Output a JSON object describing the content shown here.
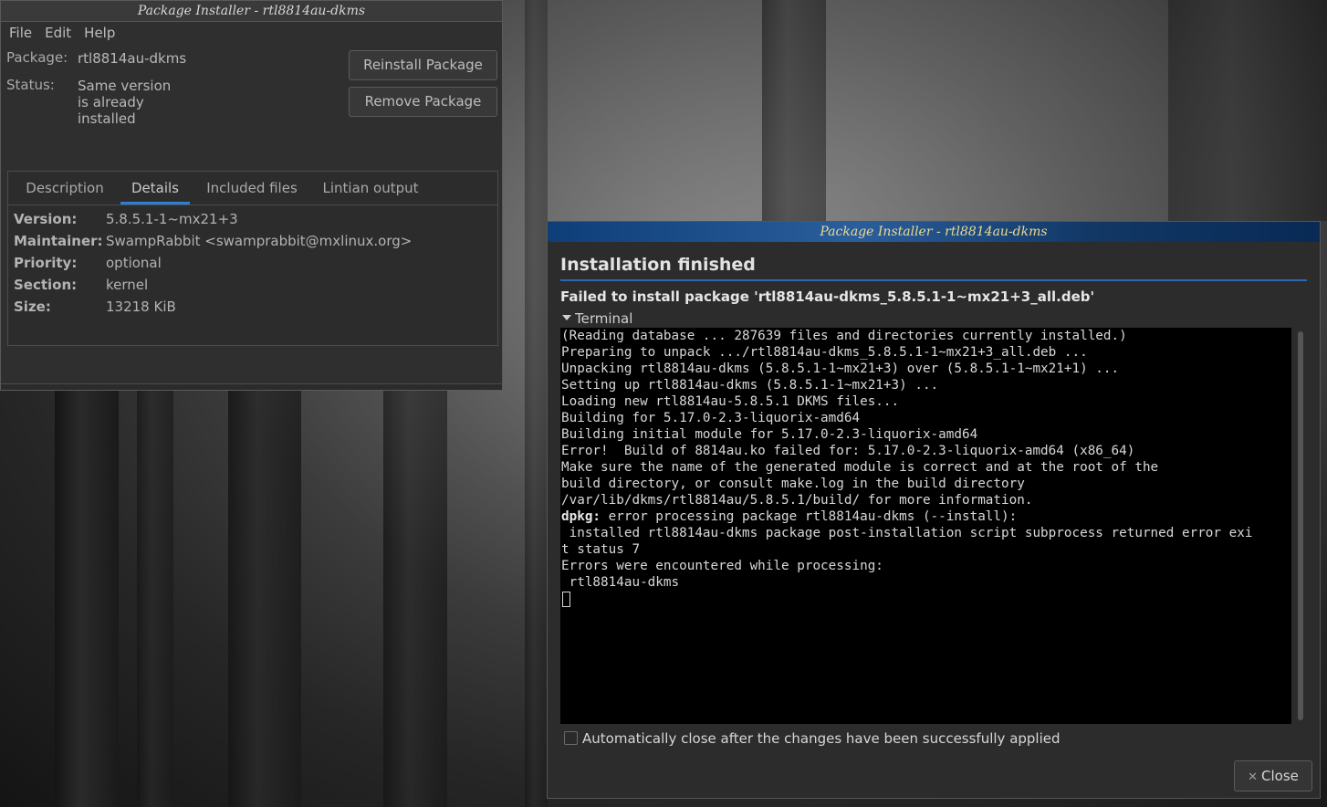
{
  "main_window": {
    "title": "Package Installer - rtl8814au-dkms",
    "menu": [
      "File",
      "Edit",
      "Help"
    ],
    "package_label": "Package:",
    "package_value": "rtl8814au-dkms",
    "status_label": "Status:",
    "status_lines": [
      "Same version",
      "is already",
      "installed"
    ],
    "reinstall_button": "Reinstall Package",
    "remove_button": "Remove Package",
    "tabs": [
      "Description",
      "Details",
      "Included files",
      "Lintian output"
    ],
    "active_tab": "Details",
    "details": [
      {
        "key": "Version:",
        "value": "5.8.5.1-1~mx21+3"
      },
      {
        "key": "Maintainer:",
        "value": "SwampRabbit <swamprabbit@mxlinux.org>"
      },
      {
        "key": "Priority:",
        "value": "optional"
      },
      {
        "key": "Section:",
        "value": "kernel"
      },
      {
        "key": "Size:",
        "value": "13218 KiB"
      }
    ]
  },
  "dialog": {
    "title": "Package Installer - rtl8814au-dkms",
    "heading": "Installation finished",
    "fail_message": "Failed to install package 'rtl8814au-dkms_5.8.5.1-1~mx21+3_all.deb'",
    "terminal_label": "Terminal",
    "terminal_lines": [
      "(Reading database ... 287639 files and directories currently installed.)",
      "Preparing to unpack .../rtl8814au-dkms_5.8.5.1-1~mx21+3_all.deb ...",
      "Unpacking rtl8814au-dkms (5.8.5.1-1~mx21+3) over (5.8.5.1-1~mx21+1) ...",
      "Setting up rtl8814au-dkms (5.8.5.1-1~mx21+3) ...",
      "Loading new rtl8814au-5.8.5.1 DKMS files...",
      "Building for 5.17.0-2.3-liquorix-amd64",
      "Building initial module for 5.17.0-2.3-liquorix-amd64",
      "Error!  Build of 8814au.ko failed for: 5.17.0-2.3-liquorix-amd64 (x86_64)",
      "Make sure the name of the generated module is correct and at the root of the",
      "build directory, or consult make.log in the build directory",
      "/var/lib/dkms/rtl8814au/5.8.5.1/build/ for more information.",
      "dpkg: error processing package rtl8814au-dkms (--install):",
      " installed rtl8814au-dkms package post-installation script subprocess returned error exi",
      "t status 7",
      "Errors were encountered while processing:",
      " rtl8814au-dkms"
    ],
    "dpkg_prefix": "dpkg:",
    "dpkg_rest": " error processing package rtl8814au-dkms (--install):",
    "auto_close_label": "Automatically close after the changes have been successfully applied",
    "auto_close_checked": false,
    "close_button": "Close"
  },
  "icons": {
    "close": "close-x-icon",
    "expander": "triangle-down-icon"
  },
  "colors": {
    "dialog_titlebar": "#1a4a86",
    "title_text": "#ecd98c",
    "tab_active_underline": "#2e7fd3",
    "terminal_bg": "#000000"
  }
}
